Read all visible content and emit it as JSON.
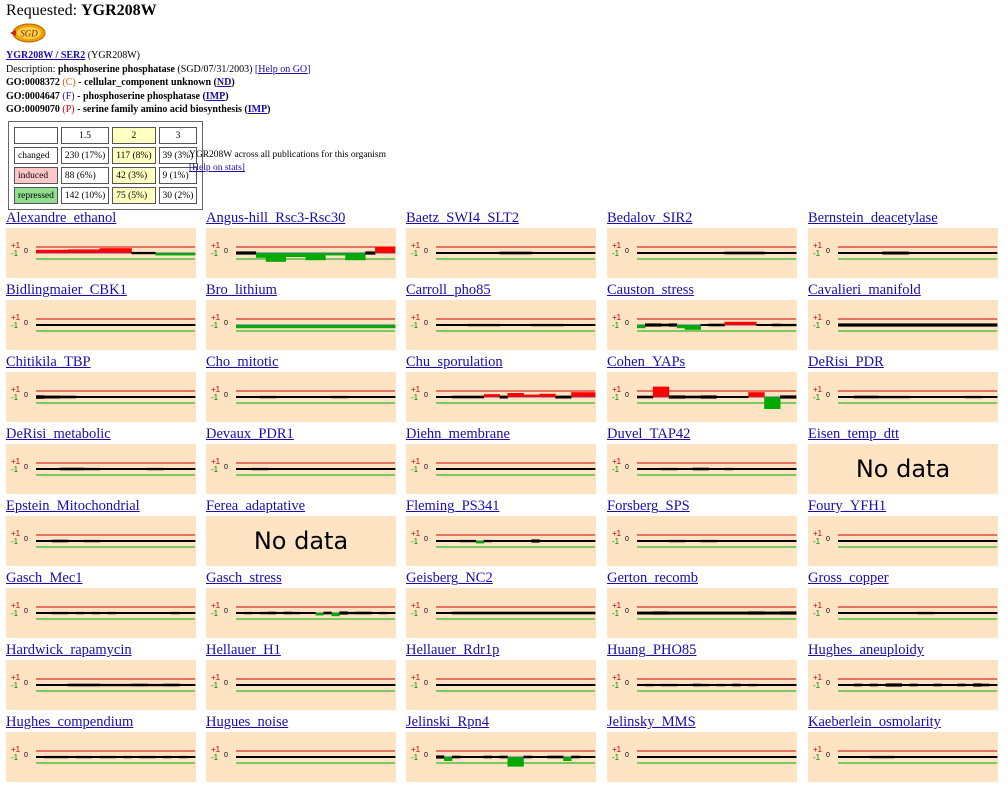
{
  "header": {
    "requested_label": "Requested:",
    "gene": "YGR208W",
    "logo_text": "SGD"
  },
  "gene_info": {
    "link": "YGR208W / SER2",
    "alias": "(YGR208W)",
    "desc_label": "Description:",
    "desc_bold": "phosphoserine phosphatase",
    "desc_rest": "(SGD/07/31/2003)",
    "help_go": "[Help on GO]",
    "go_terms": [
      {
        "id": "GO:0008372",
        "letter": "C",
        "text": "- cellular_component unknown",
        "evidence": "ND"
      },
      {
        "id": "GO:0004647",
        "letter": "F",
        "text": "- phosphoserine phosphatase",
        "evidence": "IMP"
      },
      {
        "id": "GO:0009070",
        "letter": "P",
        "text": "- serine family amino acid biosynthesis",
        "evidence": "IMP"
      }
    ]
  },
  "stats": {
    "thresholds": [
      "1.5",
      "2",
      "3"
    ],
    "rows": [
      {
        "label": "changed",
        "values": [
          "230 (17%)",
          "117 (8%)",
          "39 (3%)"
        ]
      },
      {
        "label": "induced",
        "values": [
          "88 (6%)",
          "42 (3%)",
          "9 (1%)"
        ]
      },
      {
        "label": "repressed",
        "values": [
          "142 (10%)",
          "75 (5%)",
          "30 (2%)"
        ]
      }
    ],
    "note": "YGR208W across all publications for this organism",
    "help": "[Help on stats]"
  },
  "axis": {
    "plus": "+1",
    "minus": "-1",
    "zero": "0"
  },
  "nodata_text": "No data",
  "colors": {
    "induced": "#ff0000",
    "repressed": "#00aa00",
    "neutral": "#000000",
    "missing": "#8888aa",
    "panel": "#ffe4c4",
    "link": "#1a0dab"
  },
  "datasets": [
    {
      "name": "Alexandre_ethanol",
      "values": [
        0.4,
        0.4,
        0.4,
        0.4,
        0.45,
        0.45,
        0.45,
        0.45,
        0.6,
        0.6,
        0.6,
        0.6,
        0.05,
        0.05,
        0.05,
        -0.3,
        -0.3,
        -0.3,
        -0.3,
        -0.3
      ]
    },
    {
      "name": "Angus-hill_Rsc3-Rsc30",
      "values": [
        -0.2,
        -0.2,
        -0.6,
        -1.1,
        -1.1,
        -0.5,
        -0.5,
        -0.9,
        -0.9,
        -0.3,
        -0.3,
        -0.9,
        -0.9,
        -0.2,
        0.8,
        0.8
      ]
    },
    {
      "name": "Baetz_SWI4_SLT2",
      "values": [
        0,
        0,
        0,
        0,
        0,
        0,
        0,
        0,
        -0.1,
        -0.1,
        -0.1,
        -0.1,
        0,
        0,
        0,
        0,
        0,
        0,
        0,
        0
      ]
    },
    {
      "name": "Bedalov_SIR2",
      "values": [
        0,
        0,
        0,
        0,
        0,
        0,
        0,
        0,
        0,
        0,
        0,
        0.1,
        0.1,
        0.1,
        0.1,
        0.1,
        0,
        0,
        0,
        0
      ]
    },
    {
      "name": "Bernstein_deacetylase",
      "values": [
        0,
        0,
        0,
        0,
        0,
        -0.15,
        -0.15,
        -0.15,
        0,
        0,
        0,
        0,
        0,
        0,
        0,
        0,
        0,
        0
      ]
    },
    {
      "name": "Bidlingmaier_CBK1",
      "values": [
        0,
        0,
        0,
        0,
        0,
        0,
        0,
        0,
        0,
        0,
        0,
        0,
        0,
        0,
        0,
        0,
        0,
        0,
        0,
        0
      ]
    },
    {
      "name": "Bro_lithium",
      "values": [
        -0.4,
        -0.4,
        -0.4,
        -0.4,
        -0.4,
        -0.4,
        -0.4,
        -0.4,
        -0.4,
        -0.4,
        -0.4,
        -0.4,
        -0.4,
        -0.4,
        -0.4,
        -0.4,
        -0.4,
        -0.4,
        -0.4,
        -0.4
      ]
    },
    {
      "name": "Carroll_pho85",
      "values": [
        0,
        0,
        0,
        0,
        0.05,
        0.05,
        0.05,
        0.05,
        0,
        0,
        0,
        0,
        0.05,
        0.05,
        0.05,
        0.05,
        0,
        0,
        0,
        0
      ]
    },
    {
      "name": "Causton_stress",
      "values": [
        -0.4,
        -0.2,
        -0.2,
        -0.1,
        -0.2,
        -0.4,
        -0.6,
        -0.6,
        0,
        0.1,
        0.1,
        0.4,
        0.4,
        0.4,
        0.4,
        0,
        0,
        -0.1,
        0.05,
        0.05
      ]
    },
    {
      "name": "Cavalieri_manifold",
      "values": [
        0.2,
        0.2,
        0.2,
        0.2,
        0.2,
        0.2,
        0.2,
        0.2,
        0.2,
        0.2,
        0.2,
        0.2,
        0.2,
        0.2,
        0.2,
        0.2,
        0.2,
        0.2,
        0.2,
        0.2
      ]
    },
    {
      "name": "Chitikila_TBP",
      "values": [
        0.25,
        0.15,
        0.15,
        0.1,
        0.1,
        0,
        0,
        0,
        0,
        0,
        0,
        0,
        0,
        0,
        0,
        0,
        0,
        0,
        0,
        0
      ]
    },
    {
      "name": "Cho_mitotic",
      "values": [
        0,
        0,
        0,
        0.05,
        0.05,
        0,
        0,
        0,
        0,
        0,
        0,
        0,
        0.05,
        0.05,
        0,
        0,
        0,
        0,
        0,
        0
      ]
    },
    {
      "name": "Chu_sporulation",
      "values": [
        0,
        0,
        0.1,
        0.1,
        0.1,
        0.1,
        0.35,
        0.35,
        0.15,
        0.5,
        0.5,
        0.3,
        0.3,
        0.4,
        0.4,
        0.15,
        0.15,
        0.6,
        0.6,
        0.6
      ]
    },
    {
      "name": "Cohen_YAPs",
      "values": [
        -0.1,
        -0.1,
        1.3,
        1.3,
        -0.2,
        -0.2,
        -0.1,
        -0.1,
        -0.2,
        -0.2,
        0,
        0,
        0,
        0,
        0.6,
        0.6,
        -1.5,
        -1.5,
        -0.2,
        -0.2
      ]
    },
    {
      "name": "DeRisi_PDR",
      "values": [
        0,
        0,
        0.1,
        0.1,
        0.1,
        0.05,
        0.05,
        0.05,
        0.05,
        0,
        0,
        0,
        0,
        0,
        0,
        0,
        0.05,
        0.05,
        0,
        0
      ]
    },
    {
      "name": "DeRisi_metabolic",
      "values": [
        0,
        0,
        0,
        0.1,
        0.1,
        0.1,
        0.05,
        0.05,
        0,
        0,
        0,
        0,
        0,
        0,
        -0.05,
        -0.05,
        0,
        0,
        0,
        0
      ]
    },
    {
      "name": "Devaux_PDR1",
      "values": [
        0,
        0,
        0.05,
        0.05,
        0,
        0,
        0,
        0,
        0,
        0,
        0,
        0,
        0,
        0,
        0,
        0,
        0,
        0,
        0,
        0
      ]
    },
    {
      "name": "Diehn_membrane",
      "values": [
        0,
        0,
        0,
        0,
        0,
        0,
        0,
        0,
        0,
        0,
        0,
        0,
        0,
        0,
        0,
        0,
        0,
        0,
        0,
        0
      ]
    },
    {
      "name": "Duvel_TAP42",
      "values": [
        0,
        0,
        0,
        0.05,
        0.05,
        0,
        0,
        -0.1,
        -0.1,
        0,
        0,
        0.05,
        0,
        0,
        0,
        0,
        0,
        0,
        0,
        0
      ]
    },
    {
      "name": "Eisen_temp_dtt",
      "nodata": true,
      "values": []
    },
    {
      "name": "Epstein_Mitochondrial",
      "values": [
        0,
        0,
        0.1,
        0.1,
        0,
        0,
        0.05,
        0.05,
        0,
        0,
        0,
        0,
        0,
        0,
        0,
        0,
        0,
        0,
        0,
        0
      ]
    },
    {
      "name": "Ferea_adaptative",
      "nodata": true,
      "values": []
    },
    {
      "name": "Fleming_PS341",
      "values": [
        0,
        0,
        0,
        -0.05,
        -0.05,
        -0.3,
        -0.05,
        0,
        0,
        0,
        0,
        0,
        -0.2,
        0,
        0,
        0,
        0,
        0,
        0,
        0
      ]
    },
    {
      "name": "Forsberg_SPS",
      "values": [
        0,
        0,
        0,
        0,
        0.05,
        0.05,
        0,
        0,
        -0.05,
        -0.05,
        0,
        0,
        0,
        0,
        0,
        0,
        0,
        0,
        0,
        0
      ]
    },
    {
      "name": "Foury_YFH1",
      "values": [
        0,
        0,
        0,
        0,
        0,
        0,
        0,
        0,
        0,
        0,
        0,
        0,
        0,
        0,
        0,
        0,
        0,
        0,
        0,
        0
      ]
    },
    {
      "name": "Gasch_Mec1",
      "values": [
        0,
        0,
        0.05,
        -0.05,
        0,
        0.05,
        0,
        -0.05,
        0,
        0.05,
        0,
        0,
        0,
        0,
        0,
        0,
        0,
        0.05,
        0,
        0
      ]
    },
    {
      "name": "Gasch_stress",
      "values": [
        0,
        0.05,
        0,
        -0.05,
        0.1,
        0,
        -0.1,
        0.05,
        0,
        0,
        -0.3,
        0.1,
        -0.4,
        -0.2,
        0.05,
        0.1,
        -0.1,
        0,
        0.05,
        0
      ]
    },
    {
      "name": "Geisberg_NC2",
      "values": [
        0,
        0,
        -0.1,
        -0.1,
        -0.1,
        -0.1,
        -0.1,
        -0.1,
        -0.1,
        -0.1,
        -0.1,
        -0.1,
        -0.1,
        -0.1,
        -0.1,
        -0.1,
        -0.1,
        -0.1,
        -0.1,
        -0.1
      ]
    },
    {
      "name": "Gerton_recomb",
      "values": [
        0.15,
        0.15,
        0.2,
        0.2,
        0.15,
        0.15,
        0.15,
        0.15,
        0.15,
        0.15,
        0.15,
        0.15,
        0.15,
        0.15,
        0.2,
        0.2,
        0.15,
        0.15,
        0.2,
        0.2
      ]
    },
    {
      "name": "Gross_copper",
      "values": [
        0,
        0,
        0,
        0,
        0,
        0,
        0,
        0,
        0,
        0,
        -0.05,
        -0.05,
        0,
        0,
        0,
        0,
        0,
        0,
        0,
        0
      ]
    },
    {
      "name": "Hardwick_rapamycin",
      "values": [
        0,
        0,
        0,
        0,
        -0.1,
        -0.1,
        -0.1,
        -0.1,
        -0.05,
        -0.05,
        -0.05,
        -0.05,
        -0.1,
        -0.1,
        -0.05,
        -0.05,
        -0.1,
        -0.1,
        0,
        0
      ]
    },
    {
      "name": "Hellauer_H1",
      "values": [
        0,
        0,
        0,
        0,
        0,
        0,
        0,
        0,
        0,
        0,
        0,
        0,
        0,
        0,
        0,
        0,
        0,
        0,
        0,
        0
      ]
    },
    {
      "name": "Hellauer_Rdr1p",
      "values": [
        0,
        0,
        0,
        0,
        0,
        0,
        0,
        0,
        0,
        0,
        0,
        0,
        0,
        0,
        0,
        0,
        0,
        0,
        0,
        0
      ]
    },
    {
      "name": "Huang_PHO85",
      "values": [
        0,
        -0.05,
        0,
        -0.05,
        -0.05,
        0,
        0,
        0.1,
        -0.05,
        0,
        -0.05,
        0,
        -0.1,
        0,
        -0.05,
        0,
        0,
        0,
        0,
        0
      ]
    },
    {
      "name": "Hughes_aneuploidy",
      "values": [
        0,
        0,
        -0.1,
        0,
        -0.1,
        0,
        -0.2,
        -0.2,
        0,
        -0.1,
        0,
        0,
        -0.1,
        0,
        0,
        -0.1,
        0,
        0.2,
        -0.1,
        0
      ]
    },
    {
      "name": "Hughes_compendium",
      "values": [
        0,
        0.05,
        -0.05,
        0.05,
        0,
        -0.05,
        0.05,
        0,
        0.05,
        -0.05,
        0,
        0.05,
        0,
        -0.05,
        0.05,
        0,
        0.05,
        0,
        -0.05,
        0
      ]
    },
    {
      "name": "Hugues_noise",
      "values": [
        0,
        0,
        0,
        0,
        0,
        0,
        0,
        0,
        0,
        0,
        0,
        0,
        0,
        0,
        0,
        0,
        0,
        0,
        0,
        0
      ]
    },
    {
      "name": "Jelinski_Rpn4",
      "values": [
        -0.2,
        -0.5,
        -0.1,
        0,
        0,
        0,
        -0.1,
        0,
        -0.1,
        -1.2,
        -1.2,
        -0.1,
        0,
        0,
        -0.1,
        -0.1,
        -0.5,
        -0.1,
        0,
        0
      ]
    },
    {
      "name": "Jelinsky_MMS",
      "values": [
        0,
        0,
        0,
        0,
        0,
        0,
        0,
        0,
        0,
        0,
        0,
        0,
        0,
        0,
        0,
        0,
        0,
        0,
        0,
        0
      ]
    },
    {
      "name": "Kaeberlein_osmolarity",
      "values": [
        0,
        0,
        0,
        0,
        -0.05,
        -0.05,
        -0.05,
        0,
        0,
        0,
        0,
        0,
        0,
        0,
        0,
        0,
        0,
        0,
        0,
        0
      ]
    }
  ]
}
